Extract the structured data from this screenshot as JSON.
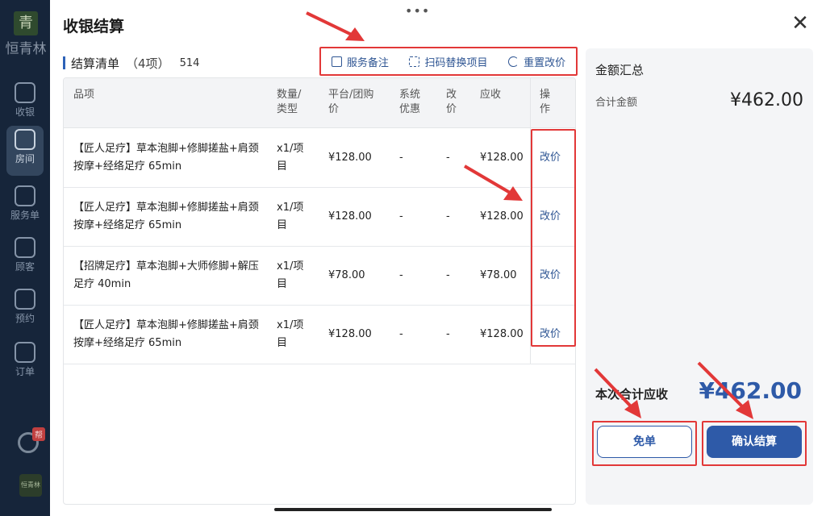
{
  "sidebar": {
    "brand_logo_char": "青",
    "brand_name": "恒青林",
    "items": [
      {
        "label": "收银",
        "icon": "cashier-icon"
      },
      {
        "label": "房间",
        "icon": "room-icon",
        "active": true
      },
      {
        "label": "服务单",
        "icon": "service-order-icon"
      },
      {
        "label": "顾客",
        "icon": "customer-icon"
      },
      {
        "label": "预约",
        "icon": "calendar-icon"
      },
      {
        "label": "订单",
        "icon": "order-icon"
      }
    ],
    "help_badge": "帮",
    "mini_logo": "恒青林"
  },
  "modal": {
    "title": "收银结算",
    "close_symbol": "✕",
    "drag_dots": "•••"
  },
  "list": {
    "title": "结算清单",
    "count": "（4项）",
    "order_no": "514"
  },
  "toolbar": {
    "note_label": "服务备注",
    "scan_label": "扫码替换项目",
    "reset_label": "重置改价"
  },
  "table": {
    "headers": {
      "name": "品项",
      "qty_l1": "数量/",
      "qty_l2": "类型",
      "price_l1": "平台/团购",
      "price_l2": "价",
      "disc_l1": "系统",
      "disc_l2": "优惠",
      "adj_l1": "改",
      "adj_l2": "价",
      "due": "应收",
      "op_l1": "操",
      "op_l2": "作"
    },
    "rows": [
      {
        "name": "【匠人足疗】草本泡脚+修脚搓盐+肩颈按摩+经络足疗 65min",
        "qty_l1": "x1/项",
        "qty_l2": "目",
        "price": "¥128.00",
        "discount": "-",
        "adjust": "-",
        "due": "¥128.00",
        "action": "改价"
      },
      {
        "name": "【匠人足疗】草本泡脚+修脚搓盐+肩颈按摩+经络足疗 65min",
        "qty_l1": "x1/项",
        "qty_l2": "目",
        "price": "¥128.00",
        "discount": "-",
        "adjust": "-",
        "due": "¥128.00",
        "action": "改价"
      },
      {
        "name": "【招牌足疗】草本泡脚+大师修脚+解压足疗 40min",
        "qty_l1": "x1/项",
        "qty_l2": "目",
        "price": "¥78.00",
        "discount": "-",
        "adjust": "-",
        "due": "¥78.00",
        "action": "改价"
      },
      {
        "name": "【匠人足疗】草本泡脚+修脚搓盐+肩颈按摩+经络足疗 65min",
        "qty_l1": "x1/项",
        "qty_l2": "目",
        "price": "¥128.00",
        "discount": "-",
        "adjust": "-",
        "due": "¥128.00",
        "action": "改价"
      }
    ]
  },
  "summary": {
    "title": "金额汇总",
    "subtotal_label": "合计金额",
    "subtotal_value": "¥462.00",
    "total_label": "本次合计应收",
    "total_value": "¥462.00",
    "free_label": "免单",
    "confirm_label": "确认结算"
  },
  "colors": {
    "accent": "#2e5aa8",
    "annotation": "#e23838"
  }
}
